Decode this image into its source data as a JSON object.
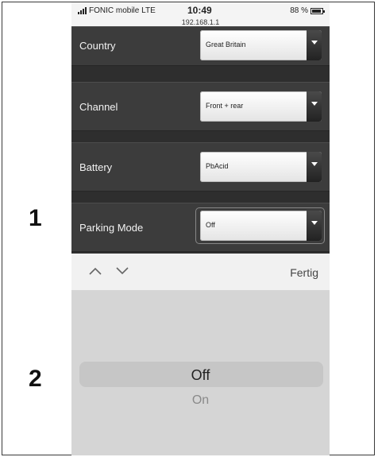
{
  "callouts": [
    "1",
    "2"
  ],
  "status_bar": {
    "carrier": "FONIC mobile",
    "network": "LTE",
    "time": "10:49",
    "url": "192.168.1.1",
    "battery_text": "88 %",
    "battery_level": 0.88
  },
  "settings": [
    {
      "label": "Country",
      "value": "Great Britain"
    },
    {
      "label": "Channel",
      "value": "Front + rear"
    },
    {
      "label": "Battery",
      "value": "PbAcid"
    },
    {
      "label": "Parking Mode",
      "value": "Off"
    }
  ],
  "toolbar": {
    "prev_icon": "chevron-up-icon",
    "next_icon": "chevron-down-icon",
    "done_label": "Fertig"
  },
  "picker": {
    "options": [
      "Off",
      "On"
    ],
    "selected": "Off"
  },
  "colors": {
    "settings_background": "#2e2e2e",
    "row_background": "#3c3c3c",
    "picker_background": "#d5d5d5"
  }
}
